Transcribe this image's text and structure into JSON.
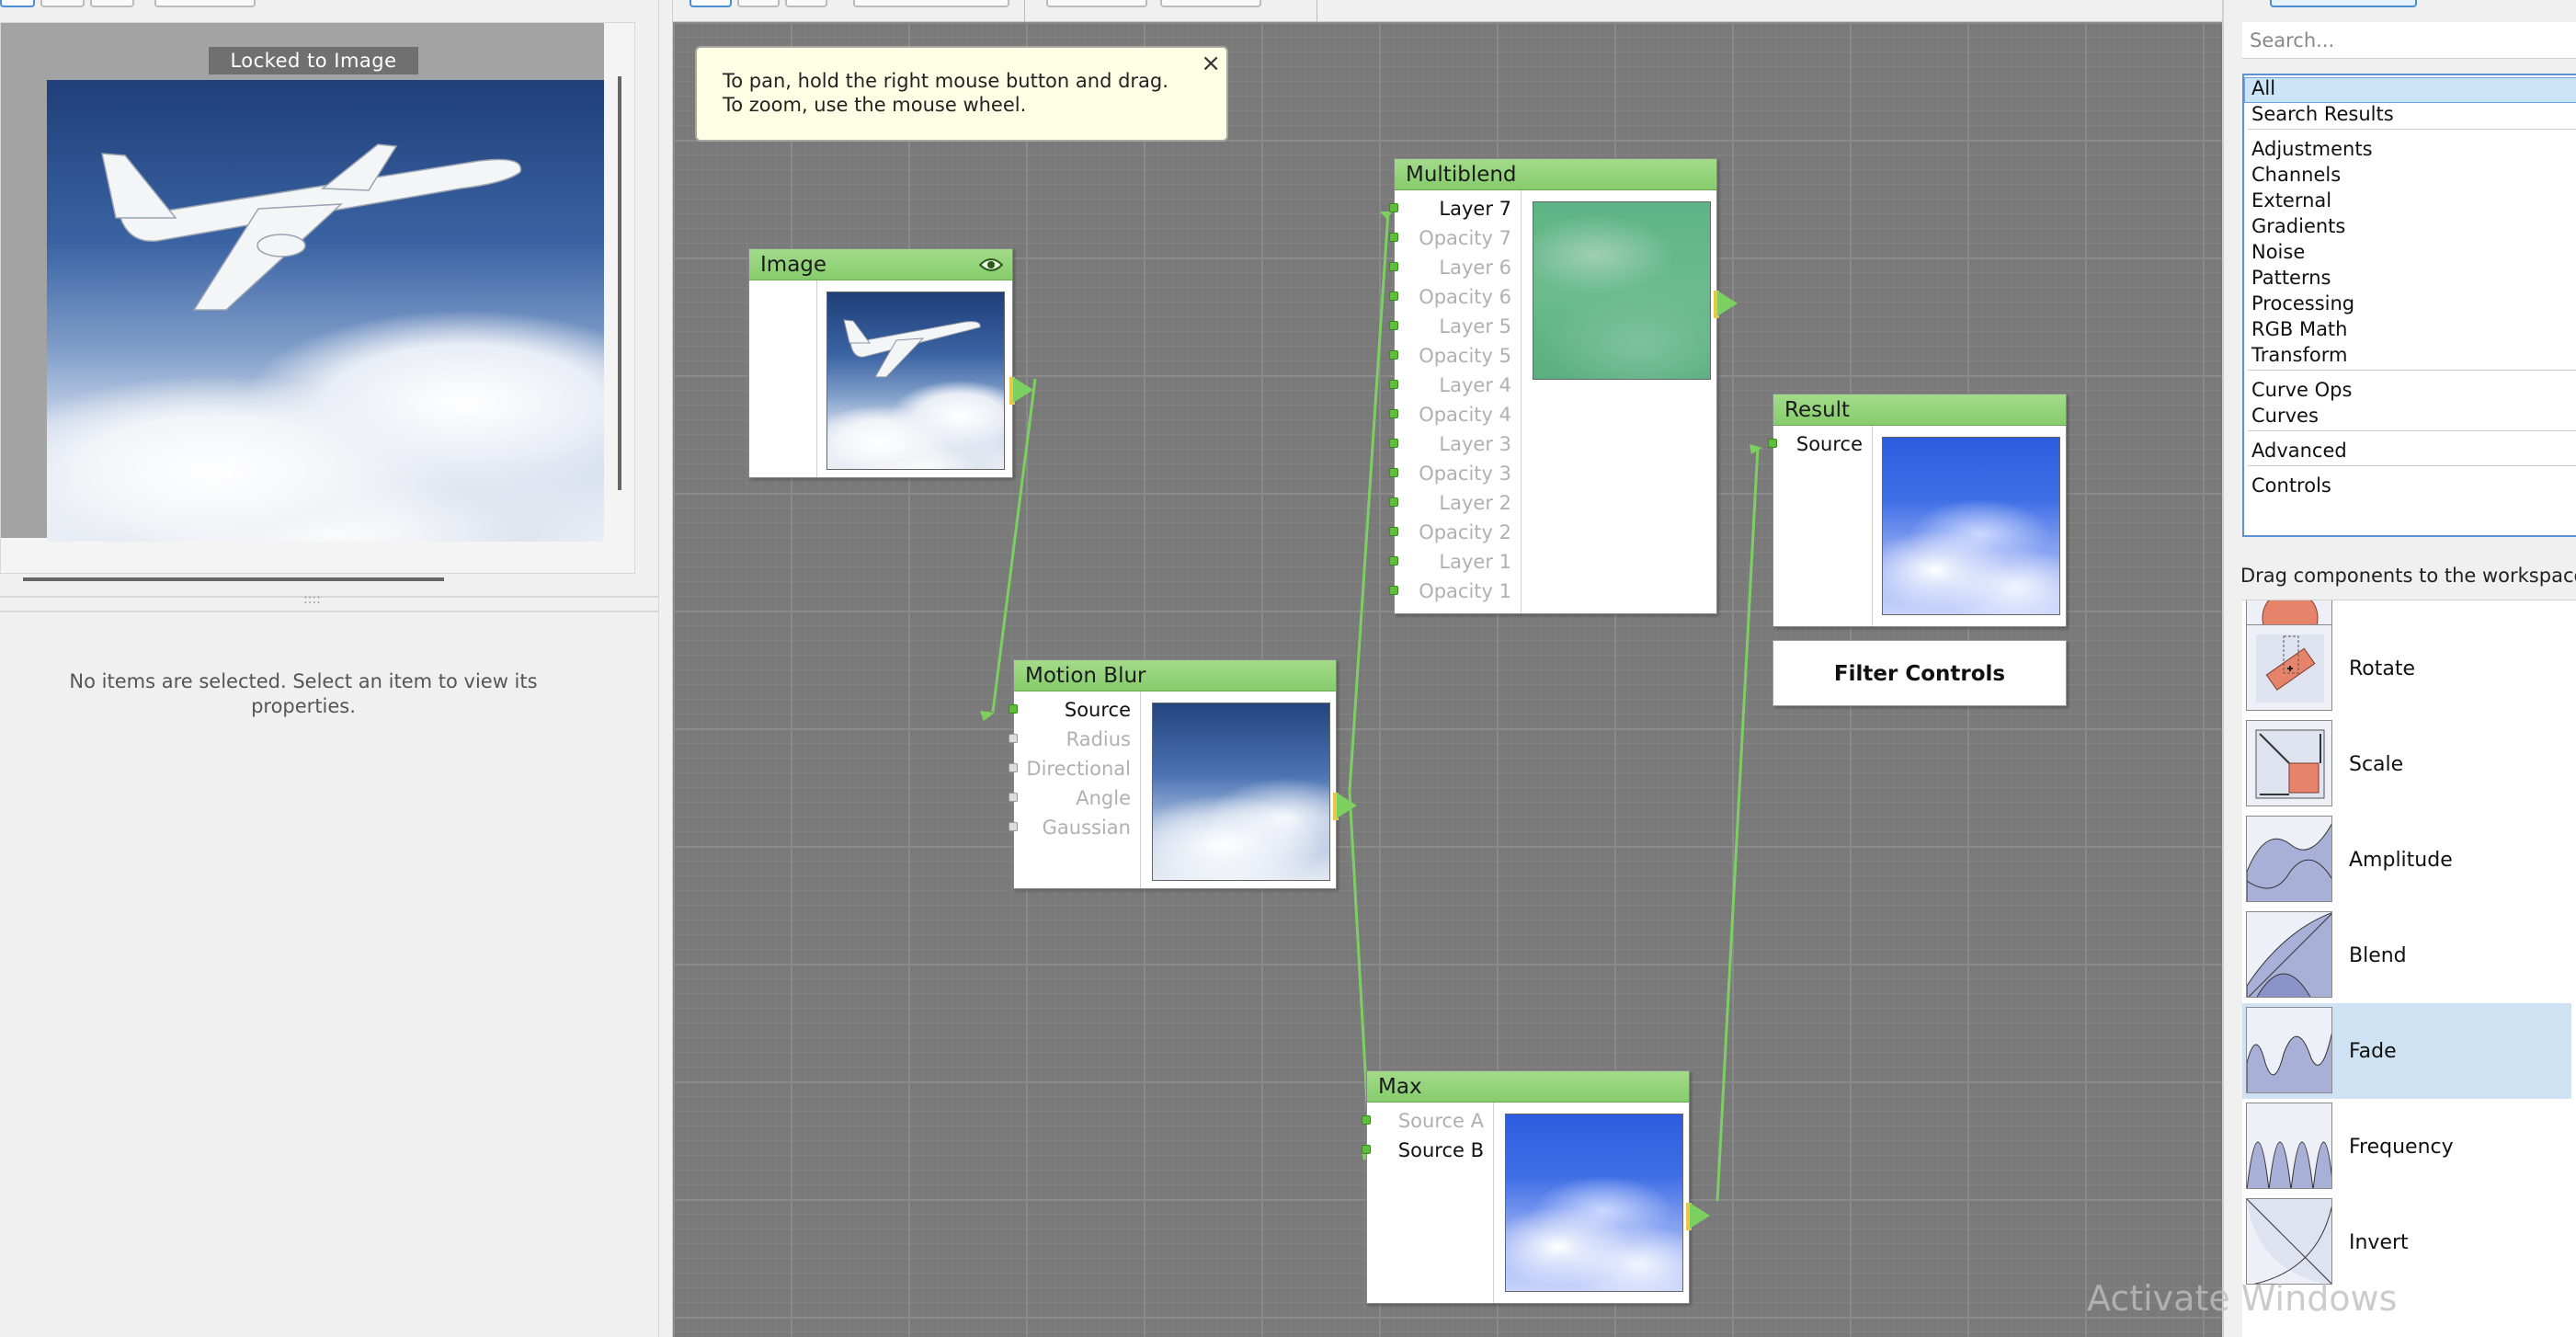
{
  "preview": {
    "locked_label": "Locked to Image"
  },
  "properties": {
    "empty_message": "No items are selected. Select an item to view its properties."
  },
  "workspace": {
    "tooltip_line1": "To pan, hold the right mouse button and drag.",
    "tooltip_line2": "To zoom, use the mouse wheel.",
    "tooltip_close": "×",
    "nodes": {
      "image": {
        "title": "Image",
        "icon": "eye-icon"
      },
      "motion_blur": {
        "title": "Motion Blur",
        "ports": [
          "Source",
          "Radius",
          "Directional",
          "Angle",
          "Gaussian"
        ]
      },
      "multiblend": {
        "title": "Multiblend",
        "ports": [
          "Layer 7",
          "Opacity 7",
          "Layer 6",
          "Opacity 6",
          "Layer 5",
          "Opacity 5",
          "Layer 4",
          "Opacity 4",
          "Layer 3",
          "Opacity 3",
          "Layer 2",
          "Opacity 2",
          "Layer 1",
          "Opacity 1"
        ]
      },
      "result": {
        "title": "Result",
        "ports": [
          "Source"
        ]
      },
      "max": {
        "title": "Max",
        "ports": [
          "Source A",
          "Source B"
        ]
      }
    },
    "filter_controls_label": "Filter Controls",
    "watermark": "Activate Windows"
  },
  "library": {
    "search_placeholder": "Search...",
    "categories": [
      "All",
      "Search Results",
      "Adjustments",
      "Channels",
      "External",
      "Gradients",
      "Noise",
      "Patterns",
      "Processing",
      "RGB Math",
      "Transform",
      "Curve Ops",
      "Curves",
      "Advanced",
      "Controls"
    ],
    "selected_category": "All",
    "drag_label": "Drag components to the workspace",
    "components": [
      "Rotate",
      "Scale",
      "Amplitude",
      "Blend",
      "Fade",
      "Frequency",
      "Invert"
    ],
    "selected_component": "Fade"
  },
  "colors": {
    "node_header": "#8fd276",
    "wire": "#7cd060",
    "selection": "#cce4f7"
  }
}
